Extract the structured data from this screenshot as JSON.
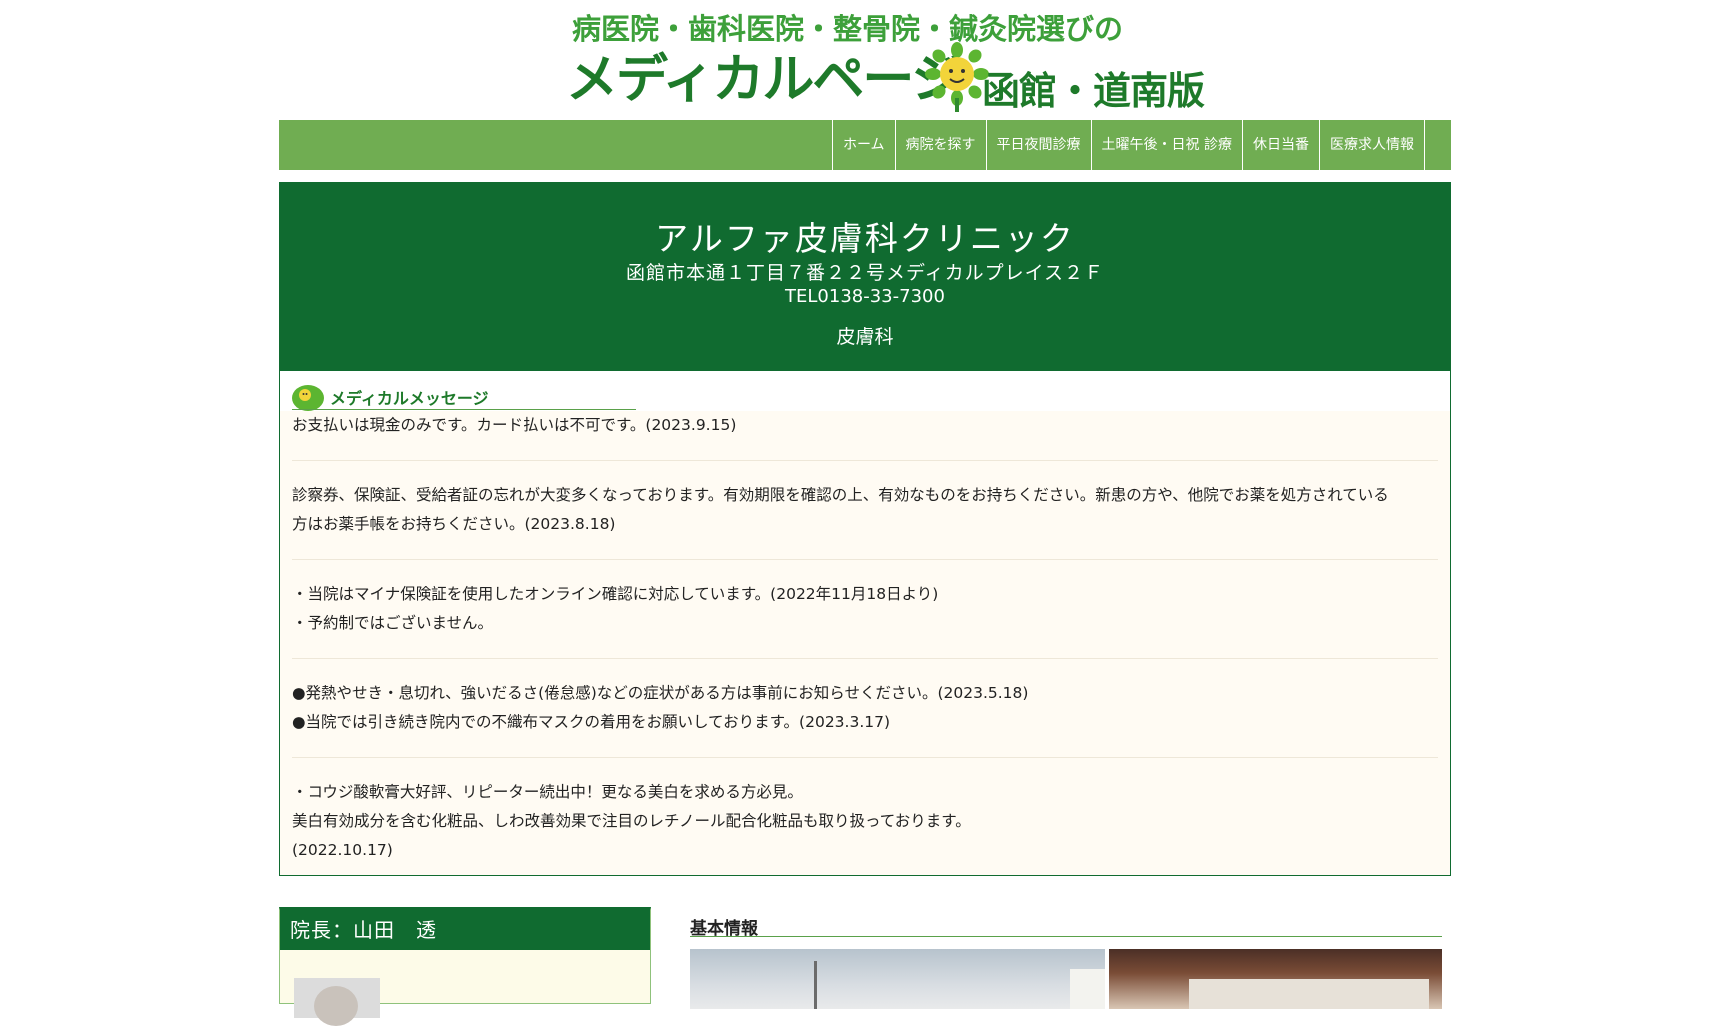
{
  "site": {
    "tagline": "病医院・歯科医院・整骨院・鍼灸院選びの",
    "logo_main": "メディカルページ",
    "edition": "函館・道南版"
  },
  "nav": {
    "items": [
      "ホーム",
      "病院を探す",
      "平日夜間診療",
      "土曜午後・日祝 診療",
      "休日当番",
      "医療求人情報"
    ]
  },
  "clinic": {
    "name": "アルファ皮膚科クリニック",
    "address": "函館市本通１丁目７番２２号メディカルプレイス２Ｆ",
    "tel": "TEL0138-33-7300",
    "department": "皮膚科"
  },
  "messages": {
    "title": "メディカルメッセージ",
    "items": [
      [
        "お支払いは現金のみです。カード払いは不可です。(2023.9.15)"
      ],
      [
        "診察券、保険証、受給者証の忘れが大変多くなっております。有効期限を確認の上、有効なものをお持ちください。新患の方や、他院でお薬を処方されている",
        "方はお薬手帳をお持ちください。(2023.8.18)"
      ],
      [
        "・当院はマイナ保険証を使用したオンライン確認に対応しています。(2022年11月18日より)",
        "・予約制ではございません。"
      ],
      [
        "●発熱やせき・息切れ、強いだるさ(倦怠感)などの症状がある方は事前にお知らせください。(2023.5.18)",
        "●当院では引き続き院内での不織布マスクの着用をお願いしております。(2023.3.17)"
      ],
      [
        "・コウジ酸軟膏大好評、リピーター続出中！更なる美白を求める方必見。",
        "美白有効成分を含む化粧品、しわ改善効果で注目のレチノール配合化粧品も取り扱っております。",
        "(2022.10.17)"
      ]
    ]
  },
  "director": {
    "label": "院長：山田　透"
  },
  "basic_info": {
    "title": "基本情報"
  },
  "colors": {
    "nav_green": "#70ad52",
    "banner_green": "#106b30",
    "logo_green": "#1e7a2a",
    "message_bg": "#fffbf3"
  }
}
